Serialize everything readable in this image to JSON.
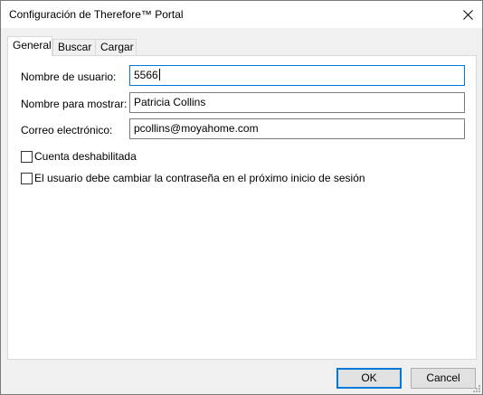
{
  "window": {
    "title": "Configuración de Therefore™ Portal"
  },
  "tabs": [
    {
      "label": "General",
      "active": true
    },
    {
      "label": "Buscar",
      "active": false
    },
    {
      "label": "Cargar",
      "active": false
    }
  ],
  "form": {
    "username_label": "Nombre de usuario:",
    "username_value": "5566",
    "display_name_label": "Nombre para mostrar:",
    "display_name_value": "Patricia Collins",
    "email_label": "Correo electrónico:",
    "email_value": "pcollins@moyahome.com",
    "account_disabled_label": "Cuenta deshabilitada",
    "account_disabled_checked": false,
    "must_change_password_label": "El usuario debe cambiar la contraseña en el próximo inicio de sesión",
    "must_change_password_checked": false
  },
  "buttons": {
    "ok_label": "OK",
    "cancel_label": "Cancel"
  },
  "colors": {
    "focus_border": "#0078d7",
    "panel_background": "#ffffff",
    "dialog_background": "#f0f0f0"
  }
}
